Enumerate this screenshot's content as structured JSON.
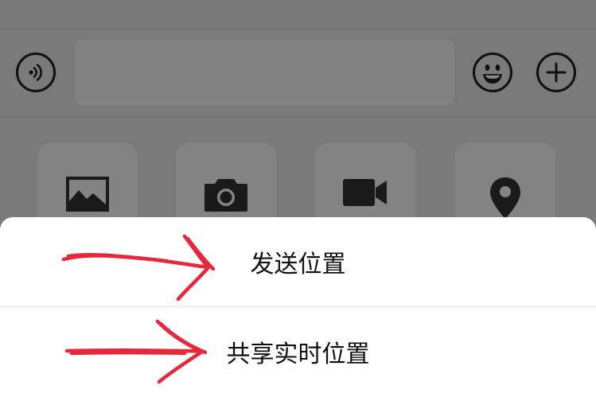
{
  "input_bar": {
    "voice_icon": "voice-wave-icon",
    "text_value": "",
    "emoji_icon": "smiley-face-icon",
    "plus_icon": "plus-circle-icon"
  },
  "attachment_tiles": [
    {
      "name": "photos",
      "icon": "image-icon"
    },
    {
      "name": "camera",
      "icon": "camera-icon"
    },
    {
      "name": "video",
      "icon": "video-camera-icon"
    },
    {
      "name": "location",
      "icon": "location-pin-icon"
    }
  ],
  "location_sheet": {
    "options": [
      {
        "label": "发送位置"
      },
      {
        "label": "共享实时位置"
      }
    ]
  },
  "annotations": {
    "color": "#e5283c",
    "arrow_count": 2
  },
  "colors": {
    "overlay_gray": "#7a7a7a",
    "sheet_background": "#ffffff"
  }
}
